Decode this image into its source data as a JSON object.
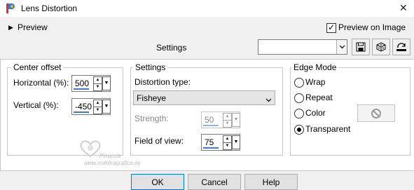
{
  "window": {
    "title": "Lens Distortion"
  },
  "header": {
    "preview_label": "Preview",
    "preview_on_image_label": "Preview on Image",
    "preview_on_image_checked": true,
    "settings_label": "Settings",
    "preset_value": ""
  },
  "center_offset": {
    "title": "Center offset",
    "horizontal_label": "Horizontal (%):",
    "horizontal_value": "500",
    "vertical_label": "Vertical (%):",
    "vertical_value": "-450"
  },
  "settings": {
    "title": "Settings",
    "distortion_type_label": "Distortion type:",
    "distortion_type_value": "Fisheye",
    "strength_label": "Strength:",
    "strength_value": "50",
    "field_of_view_label": "Field of view:",
    "field_of_view_value": "75"
  },
  "edge_mode": {
    "title": "Edge Mode",
    "options": [
      "Wrap",
      "Repeat",
      "Color",
      "Transparent"
    ],
    "selected": "Transparent"
  },
  "watermark": {
    "line1": "Pinuccia",
    "line2": "www.maldiragrafica.eu"
  },
  "buttons": {
    "ok": "OK",
    "cancel": "Cancel",
    "help": "Help"
  }
}
